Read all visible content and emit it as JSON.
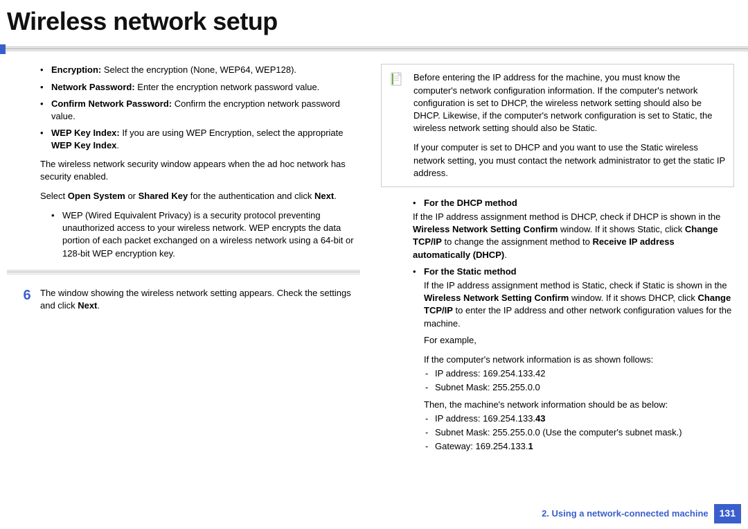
{
  "title": "Wireless network setup",
  "left": {
    "items": [
      {
        "label": "Encryption:",
        "text": " Select the encryption (None, WEP64, WEP128)."
      },
      {
        "label": "Network Password:",
        "text": " Enter the encryption network password value."
      },
      {
        "label": "Confirm Network Password:",
        "text": " Confirm the encryption network password value."
      },
      {
        "label": "WEP Key Index:",
        "text": " If you are using WEP Encryption, select the appropriate ",
        "tail": "WEP Key Index",
        "after": "."
      }
    ],
    "para1": "The wireless network security window appears when the ad hoc network has security enabled.",
    "para2_pre": "Select ",
    "para2_b1": "Open System",
    "para2_mid": " or ",
    "para2_b2": "Shared Key",
    "para2_post": " for the authentication and click ",
    "para2_b3": "Next",
    "para2_end": ".",
    "wep": "WEP (Wired Equivalent Privacy) is a security protocol preventing unauthorized access to your wireless network. WEP encrypts the data portion of each packet exchanged on a wireless network using a 64-bit or 128-bit WEP encryption key.",
    "step_num": "6",
    "step_text": "The window showing the wireless network setting appears. Check the settings and click ",
    "step_b": "Next",
    "step_end": "."
  },
  "right": {
    "note": "Before entering the IP address for the machine, you must know the computer's network configuration information. If the computer's network configuration is set to DHCP, the wireless network setting should also be DHCP. Likewise, if the computer's network configuration is set to Static, the wireless network setting should also be Static.",
    "note2": "If your computer is set to DHCP and you want to use the Static wireless network setting, you must contact the network administrator to get the static IP address.",
    "dhcp_title": "For the DHCP method",
    "dhcp_body_pre": "If the IP address assignment method is DHCP, check if DHCP is shown in the ",
    "dhcp_b1": "Wireless Network Setting Confirm",
    "dhcp_body_mid": " window. If it shows Static, click ",
    "dhcp_b2": "Change TCP/IP",
    "dhcp_body_mid2": " to change the assignment method to ",
    "dhcp_b3": "Receive IP address automatically (DHCP)",
    "dhcp_body_end": ".",
    "static_title": "For the Static method",
    "static_body_pre": "If the IP address assignment method is Static, check if Static is shown in the ",
    "static_b1": "Wireless Network Setting Confirm",
    "static_body_mid": " window. If it shows DHCP, click ",
    "static_b2": "Change TCP/IP",
    "static_body_mid2": " to enter the IP address and other network configuration values for the machine.",
    "for_example": "For example,",
    "comp_info": "If the computer's network information is as shown follows:",
    "comp_ip": "IP address: 169.254.133.42",
    "comp_mask": "Subnet Mask: 255.255.0.0",
    "machine_info": "Then, the machine's network information should be as below:",
    "m_ip_pre": "IP address: 169.254.133.",
    "m_ip_b": "43",
    "m_mask": "Subnet Mask: 255.255.0.0 (Use the computer's subnet mask.)",
    "m_gw_pre": "Gateway: 169.254.133.",
    "m_gw_b": "1"
  },
  "footer": {
    "text": "2.  Using a network-connected machine",
    "page": "131"
  }
}
